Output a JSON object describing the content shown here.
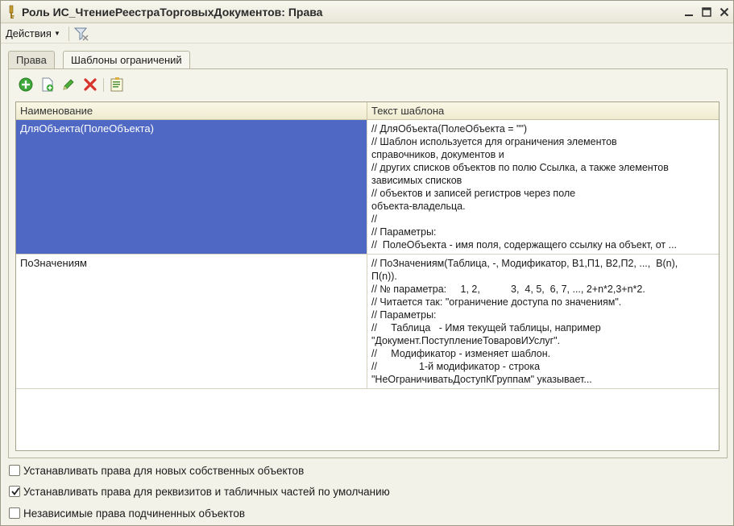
{
  "window": {
    "title": "Роль ИС_ЧтениеРеестраТорговыхДокументов: Права"
  },
  "command_bar": {
    "actions_label": "Действия"
  },
  "tabs": [
    {
      "label": "Права",
      "active": false
    },
    {
      "label": "Шаблоны ограничений",
      "active": true
    }
  ],
  "table": {
    "columns": [
      "Наименование",
      "Текст шаблона"
    ],
    "rows": [
      {
        "name": "ДляОбъекта(ПолеОбъекта)",
        "selected": true,
        "template_lines": [
          "// ДляОбъекта(ПолеОбъекта = \"\")",
          "// Шаблон используется для ограничения элементов",
          "справочников, документов и",
          "// других списков объектов по полю Ссылка, а также элементов",
          "зависимых списков",
          "// объектов и записей регистров через поле",
          "объекта-владельца.",
          "//",
          "// Параметры:",
          "//  ПолеОбъекта - имя поля, содержащего ссылку на объект, от ..."
        ]
      },
      {
        "name": "ПоЗначениям",
        "selected": false,
        "template_lines": [
          "// ПоЗначениям(Таблица, -, Модификатор, В1,П1, В2,П2, ...,  В(n),",
          "П(n)).",
          "// № параметра:     1, 2,           3,  4, 5,  6, 7, ..., 2+n*2,3+n*2.",
          "// Читается так: \"ограничение доступа по значениям\".",
          "// Параметры:",
          "//     Таблица   - Имя текущей таблицы, например",
          "\"Документ.ПоступлениеТоваровИУслуг\".",
          "//     Модификатор - изменяет шаблон.",
          "//               1-й модификатор - строка",
          "\"НеОграничиватьДоступКГруппам\" указывает..."
        ]
      }
    ]
  },
  "checkboxes": [
    {
      "label": "Устанавливать права для новых собственных объектов",
      "checked": false
    },
    {
      "label": "Устанавливать права для реквизитов и табличных частей по умолчанию",
      "checked": true
    },
    {
      "label": "Независимые права подчиненных объектов",
      "checked": false
    }
  ],
  "colors": {
    "selection": "#4f68c4",
    "add_green": "#3fa83a",
    "delete_red": "#d8342b"
  }
}
